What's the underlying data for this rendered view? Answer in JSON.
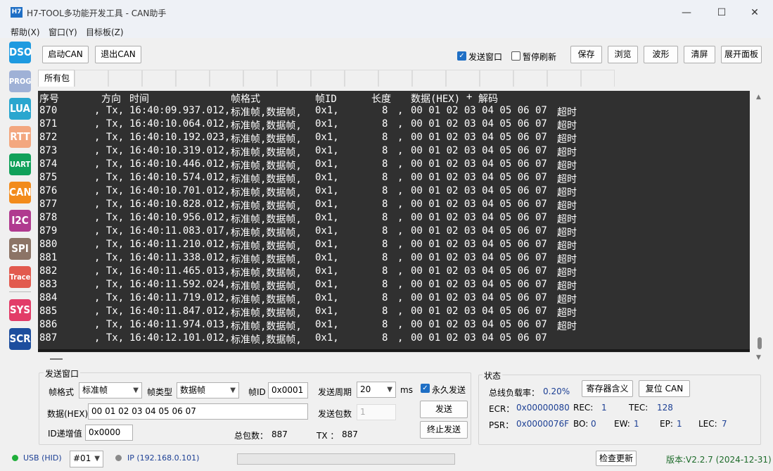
{
  "window": {
    "icon_text": "H7",
    "title": "H7-TOOL多功能开发工具 - CAN助手",
    "minimize": "—",
    "maximize": "☐",
    "close": "✕"
  },
  "menu": [
    "帮助(X)",
    "窗口(Y)",
    "目标板(Z)"
  ],
  "sidebar": [
    {
      "label": "DSO",
      "color": "#1e9ae0"
    },
    {
      "label": "PROG",
      "color": "#9fb1d6"
    },
    {
      "label": "LUA",
      "color": "#2aa6cf"
    },
    {
      "label": "RTT",
      "color": "#f3a77f"
    },
    {
      "label": "UART",
      "color": "#11a15a"
    },
    {
      "label": "CAN",
      "color": "#f28b1c"
    },
    {
      "label": "I2C",
      "color": "#b03a8f"
    },
    {
      "label": "SPI",
      "color": "#8c7466"
    },
    {
      "label": "Trace",
      "color": "#e25a4e"
    },
    {
      "label": "SYS",
      "color": "#e23c68"
    },
    {
      "label": "SCR",
      "color": "#1d4e9e"
    }
  ],
  "toolbar": {
    "start_can": "启动CAN",
    "exit_can": "退出CAN",
    "send_window_label": "发送窗口",
    "send_window_checked": true,
    "pause_refresh_label": "暂停刷新",
    "pause_refresh_checked": false,
    "save": "保存",
    "browse": "浏览",
    "waveform": "波形",
    "clear": "清屏",
    "expand_panel": "展开面板"
  },
  "tabs": {
    "active": "所有包"
  },
  "console": {
    "headers": [
      "序号",
      "方向",
      "时间",
      "帧格式",
      "帧ID",
      "长度",
      "数据(HEX)",
      "+",
      "解码"
    ],
    "rows": [
      {
        "seq": "870",
        "dir": ", Tx,",
        "time": "16:40:09.937.012,",
        "fmt": "标准帧,数据帧,",
        "id": "0x1,",
        "len": "8",
        "sep": ",",
        "data": "00 01 02 03 04 05 06 07",
        "decode": "超时"
      },
      {
        "seq": "871",
        "dir": ", Tx,",
        "time": "16:40:10.064.012,",
        "fmt": "标准帧,数据帧,",
        "id": "0x1,",
        "len": "8",
        "sep": ",",
        "data": "00 01 02 03 04 05 06 07",
        "decode": "超时"
      },
      {
        "seq": "872",
        "dir": ", Tx,",
        "time": "16:40:10.192.023,",
        "fmt": "标准帧,数据帧,",
        "id": "0x1,",
        "len": "8",
        "sep": ",",
        "data": "00 01 02 03 04 05 06 07",
        "decode": "超时"
      },
      {
        "seq": "873",
        "dir": ", Tx,",
        "time": "16:40:10.319.012,",
        "fmt": "标准帧,数据帧,",
        "id": "0x1,",
        "len": "8",
        "sep": ",",
        "data": "00 01 02 03 04 05 06 07",
        "decode": "超时"
      },
      {
        "seq": "874",
        "dir": ", Tx,",
        "time": "16:40:10.446.012,",
        "fmt": "标准帧,数据帧,",
        "id": "0x1,",
        "len": "8",
        "sep": ",",
        "data": "00 01 02 03 04 05 06 07",
        "decode": "超时"
      },
      {
        "seq": "875",
        "dir": ", Tx,",
        "time": "16:40:10.574.012,",
        "fmt": "标准帧,数据帧,",
        "id": "0x1,",
        "len": "8",
        "sep": ",",
        "data": "00 01 02 03 04 05 06 07",
        "decode": "超时"
      },
      {
        "seq": "876",
        "dir": ", Tx,",
        "time": "16:40:10.701.012,",
        "fmt": "标准帧,数据帧,",
        "id": "0x1,",
        "len": "8",
        "sep": ",",
        "data": "00 01 02 03 04 05 06 07",
        "decode": "超时"
      },
      {
        "seq": "877",
        "dir": ", Tx,",
        "time": "16:40:10.828.012,",
        "fmt": "标准帧,数据帧,",
        "id": "0x1,",
        "len": "8",
        "sep": ",",
        "data": "00 01 02 03 04 05 06 07",
        "decode": "超时"
      },
      {
        "seq": "878",
        "dir": ", Tx,",
        "time": "16:40:10.956.012,",
        "fmt": "标准帧,数据帧,",
        "id": "0x1,",
        "len": "8",
        "sep": ",",
        "data": "00 01 02 03 04 05 06 07",
        "decode": "超时"
      },
      {
        "seq": "879",
        "dir": ", Tx,",
        "time": "16:40:11.083.017,",
        "fmt": "标准帧,数据帧,",
        "id": "0x1,",
        "len": "8",
        "sep": ",",
        "data": "00 01 02 03 04 05 06 07",
        "decode": "超时"
      },
      {
        "seq": "880",
        "dir": ", Tx,",
        "time": "16:40:11.210.012,",
        "fmt": "标准帧,数据帧,",
        "id": "0x1,",
        "len": "8",
        "sep": ",",
        "data": "00 01 02 03 04 05 06 07",
        "decode": "超时"
      },
      {
        "seq": "881",
        "dir": ", Tx,",
        "time": "16:40:11.338.012,",
        "fmt": "标准帧,数据帧,",
        "id": "0x1,",
        "len": "8",
        "sep": ",",
        "data": "00 01 02 03 04 05 06 07",
        "decode": "超时"
      },
      {
        "seq": "882",
        "dir": ", Tx,",
        "time": "16:40:11.465.013,",
        "fmt": "标准帧,数据帧,",
        "id": "0x1,",
        "len": "8",
        "sep": ",",
        "data": "00 01 02 03 04 05 06 07",
        "decode": "超时"
      },
      {
        "seq": "883",
        "dir": ", Tx,",
        "time": "16:40:11.592.024,",
        "fmt": "标准帧,数据帧,",
        "id": "0x1,",
        "len": "8",
        "sep": ",",
        "data": "00 01 02 03 04 05 06 07",
        "decode": "超时"
      },
      {
        "seq": "884",
        "dir": ", Tx,",
        "time": "16:40:11.719.012,",
        "fmt": "标准帧,数据帧,",
        "id": "0x1,",
        "len": "8",
        "sep": ",",
        "data": "00 01 02 03 04 05 06 07",
        "decode": "超时"
      },
      {
        "seq": "885",
        "dir": ", Tx,",
        "time": "16:40:11.847.012,",
        "fmt": "标准帧,数据帧,",
        "id": "0x1,",
        "len": "8",
        "sep": ",",
        "data": "00 01 02 03 04 05 06 07",
        "decode": "超时"
      },
      {
        "seq": "886",
        "dir": ", Tx,",
        "time": "16:40:11.974.013,",
        "fmt": "标准帧,数据帧,",
        "id": "0x1,",
        "len": "8",
        "sep": ",",
        "data": "00 01 02 03 04 05 06 07",
        "decode": "超时"
      },
      {
        "seq": "887",
        "dir": ", Tx,",
        "time": "16:40:12.101.012,",
        "fmt": "标准帧,数据帧,",
        "id": "0x1,",
        "len": "8",
        "sep": ",",
        "data": "00 01 02 03 04 05 06 07",
        "decode": ""
      }
    ]
  },
  "send_panel": {
    "title": "发送窗口",
    "frame_format_label": "帧格式",
    "frame_format_value": "标准帧",
    "frame_type_label": "帧类型",
    "frame_type_value": "数据帧",
    "frame_id_label": "帧ID",
    "frame_id_value": "0x0001",
    "period_label": "发送周期",
    "period_value": "20",
    "period_unit": "ms",
    "forever_label": "永久发送",
    "forever_checked": true,
    "data_label": "数据(HEX)",
    "data_value": "00 01 02 03 04 05 06 07",
    "count_label": "发送包数",
    "count_value": "1",
    "send_button": "发送",
    "id_inc_label": "ID递增值",
    "id_inc_value": "0x0000",
    "total_label": "总包数：",
    "total_value": "887",
    "tx_label": "TX ：",
    "tx_value": "887",
    "stop_button": "终止发送"
  },
  "status_panel": {
    "title": "状态",
    "busload_label": "总线负载率：",
    "busload_value": "0.20%",
    "register_meaning_button": "寄存器含义",
    "reset_can_button": "复位 CAN",
    "ecr_label": "ECR：",
    "ecr_value": "0x00000080",
    "rec_label": "REC:",
    "rec_value": "1",
    "tec_label": "TEC:",
    "tec_value": "128",
    "psr_label": "PSR：",
    "psr_value": "0x0000076F",
    "bo_label": "BO:",
    "bo_value": "0",
    "ew_label": "EW:",
    "ew_value": "1",
    "ep_label": "EP:",
    "ep_value": "1",
    "lec_label": "LEC:",
    "lec_value": "7"
  },
  "statusbar": {
    "usb_label": "USB (HID)",
    "usb_color": "#1fae3a",
    "device_value": "#01",
    "ip_label": "IP (192.168.0.101)",
    "ip_color": "#8a8a8a",
    "check_update": "检查更新",
    "version": "版本:V2.2.7 (2024-12-31)"
  }
}
